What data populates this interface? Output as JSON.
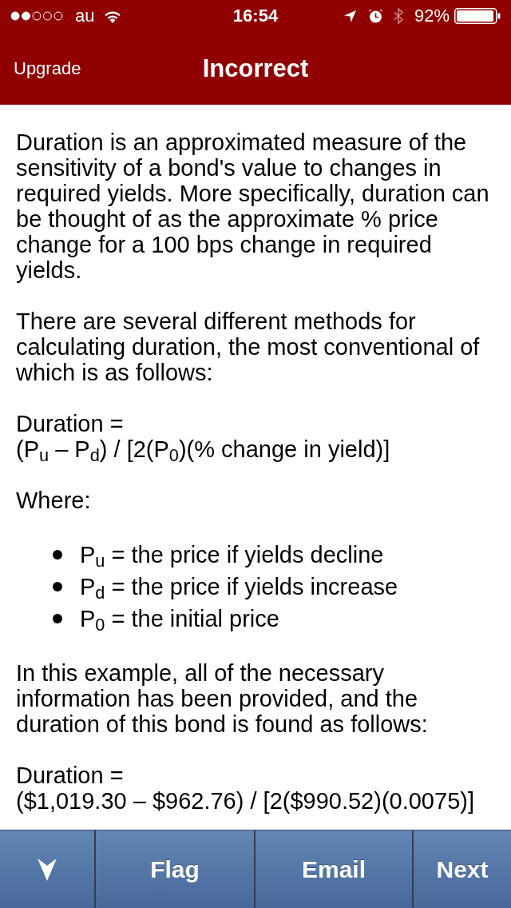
{
  "status_bar": {
    "carrier": "au",
    "time": "16:54",
    "battery": "92%"
  },
  "nav_bar": {
    "left_button": "Upgrade",
    "title": "Incorrect"
  },
  "content": [
    {
      "kind": "paragraph",
      "text": "Duration is an approximated measure of the sensitivity of a bond's value to changes in required yields. More specifically, duration can be thought of as the approximate % price change for a 100 bps change in required yields."
    },
    {
      "kind": "paragraph",
      "text": "There are several different methods for calculating duration, the most conventional of which is as follows:"
    },
    {
      "kind": "formula",
      "lines": [
        "Duration =",
        "(P$_{u}$ – P$_{d}$) / [2(P$_{0}$)(% change in yield)]"
      ]
    },
    {
      "kind": "paragraph",
      "text": "Where:"
    },
    {
      "kind": "bullets",
      "items": [
        "P$_{u}$ = the price if yields decline",
        "P$_{d}$ = the price if yields increase",
        "P$_{0}$ = the initial price"
      ]
    },
    {
      "kind": "paragraph",
      "text": "In this example, all of the necessary information has been provided, and the duration of this bond is found as follows:"
    },
    {
      "kind": "formula",
      "lines": [
        "Duration =",
        "($1,019.30 – $962.76) / [2($990.52)(0.0075)]"
      ]
    }
  ],
  "toolbar": {
    "buttons": [
      {
        "kind": "icon"
      },
      {
        "kind": "text",
        "label": "Flag"
      },
      {
        "kind": "text",
        "label": "Email"
      },
      {
        "kind": "text",
        "label": "Next"
      }
    ]
  }
}
